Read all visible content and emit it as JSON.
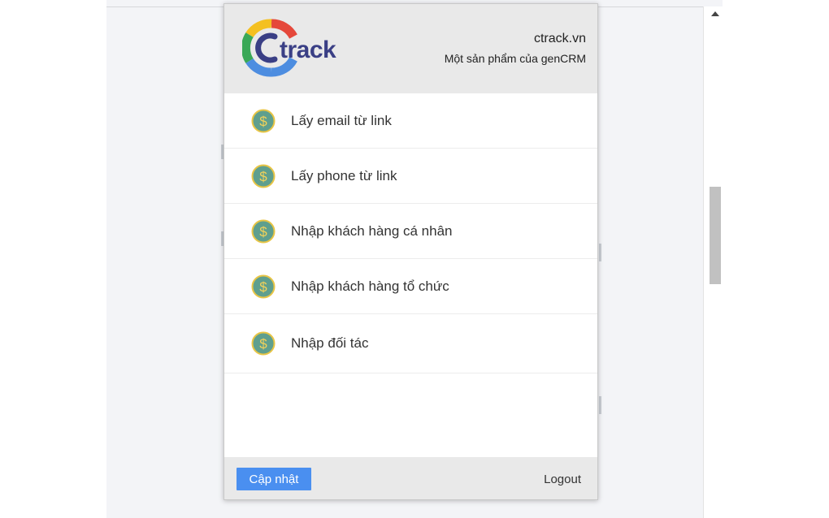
{
  "header": {
    "site_name": "ctrack.vn",
    "tagline": "Một sản phẩm của genCRM",
    "logo_text": "Ctrack"
  },
  "menu": {
    "items": [
      {
        "label": "Lấy email từ link",
        "icon": "dollar-coin-icon"
      },
      {
        "label": "Lấy phone từ link",
        "icon": "dollar-coin-icon"
      },
      {
        "label": "Nhập khách hàng cá nhân",
        "icon": "dollar-coin-icon"
      },
      {
        "label": "Nhập khách hàng tổ chức",
        "icon": "dollar-coin-icon"
      },
      {
        "label": "Nhập đối tác",
        "icon": "dollar-coin-icon"
      }
    ]
  },
  "footer": {
    "update_label": "Cập nhật",
    "logout_label": "Logout"
  },
  "colors": {
    "accent": "#4a8ff0",
    "coin_fill": "#5f9f8e",
    "coin_ring": "#e8c545",
    "header_bg": "#e9e9e9"
  }
}
